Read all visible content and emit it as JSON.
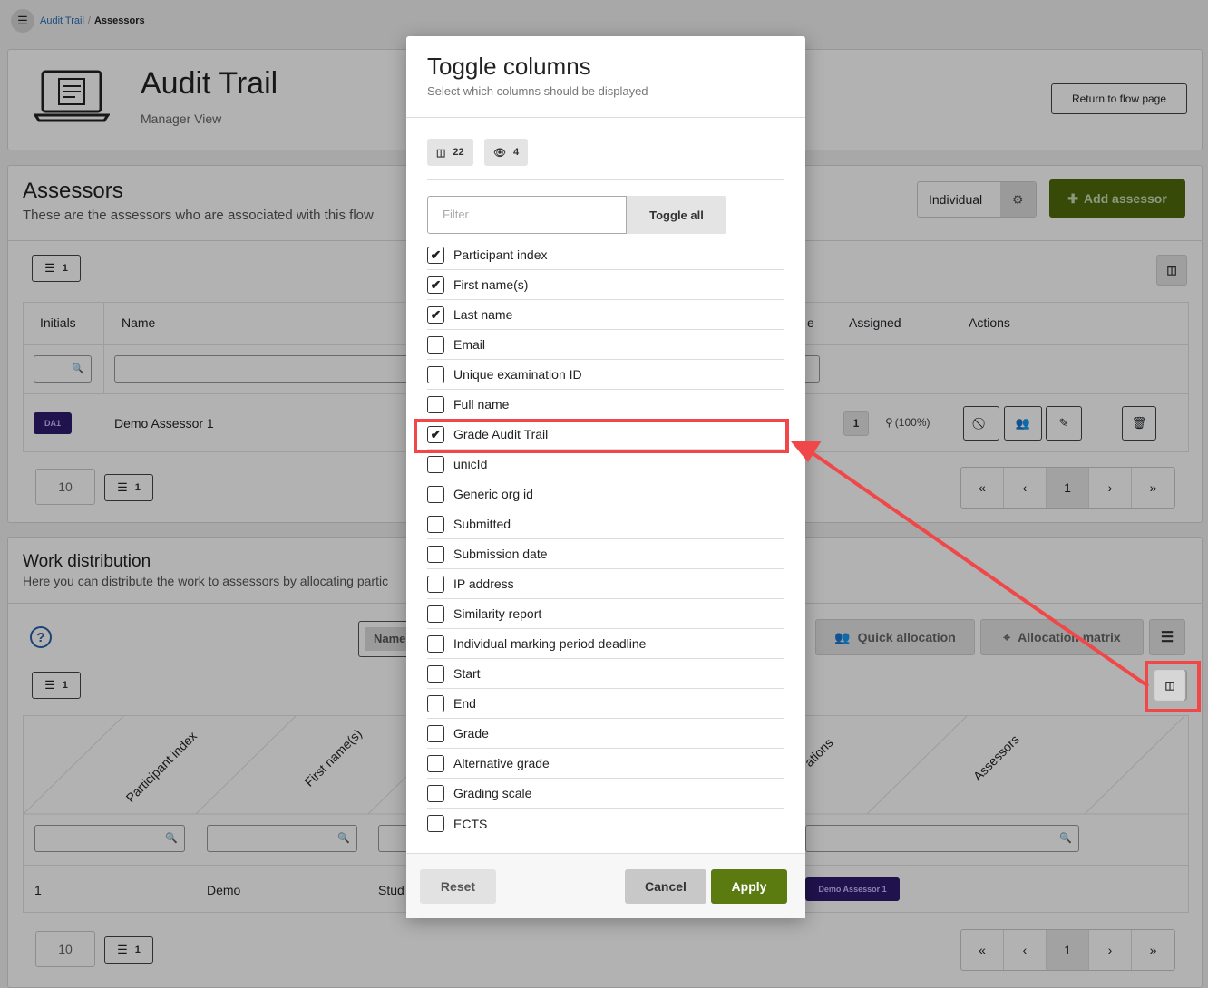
{
  "breadcrumb": {
    "root": "Audit Trail",
    "sep": "/",
    "current": "Assessors"
  },
  "header": {
    "title": "Audit Trail",
    "subtitle": "Manager View",
    "return_button": "Return to flow page"
  },
  "assessors": {
    "title": "Assessors",
    "description": "These are the assessors who are associated with this flow",
    "mode_label": "Individual",
    "add_button": "Add assessor",
    "list_count": "1",
    "columns": {
      "initials": "Initials",
      "name": "Name",
      "e": "e",
      "assigned": "Assigned",
      "actions": "Actions"
    },
    "row": {
      "initials": "DA1",
      "name": "Demo Assessor 1",
      "assigned": "1",
      "percent": "(100%)"
    },
    "page_size": "10",
    "page_count": "1",
    "pagination": {
      "first": "«",
      "prev": "‹",
      "current": "1",
      "next": "›",
      "last": "»"
    }
  },
  "work": {
    "title": "Work distribution",
    "description": "Here you can distribute the work to assessors by allocating partic",
    "select_label": "Name",
    "quick_allocation": "Quick allocation",
    "allocation_matrix": "Allocation matrix",
    "list_count": "1",
    "headers": [
      "Participant index",
      "First name(s)",
      "ations",
      "Assessors"
    ],
    "row": {
      "index": "1",
      "first": "Demo",
      "last": "Stud",
      "assessor": "Demo Assessor 1"
    },
    "page_size": "10",
    "page_count": "1",
    "pagination": {
      "first": "«",
      "prev": "‹",
      "current": "1",
      "next": "›",
      "last": "»"
    }
  },
  "modal": {
    "title": "Toggle columns",
    "subtitle": "Select which columns should be displayed",
    "total_columns": "22",
    "visible_columns": "4",
    "filter_placeholder": "Filter",
    "toggle_all": "Toggle all",
    "columns": [
      {
        "label": "Participant index",
        "checked": true
      },
      {
        "label": "First name(s)",
        "checked": true
      },
      {
        "label": "Last name",
        "checked": true
      },
      {
        "label": "Email",
        "checked": false
      },
      {
        "label": "Unique examination ID",
        "checked": false
      },
      {
        "label": "Full name",
        "checked": false
      },
      {
        "label": "Grade Audit Trail",
        "checked": true
      },
      {
        "label": "unicId",
        "checked": false
      },
      {
        "label": "Generic org id",
        "checked": false
      },
      {
        "label": "Submitted",
        "checked": false
      },
      {
        "label": "Submission date",
        "checked": false
      },
      {
        "label": "IP address",
        "checked": false
      },
      {
        "label": "Similarity report",
        "checked": false
      },
      {
        "label": "Individual marking period deadline",
        "checked": false
      },
      {
        "label": "Start",
        "checked": false
      },
      {
        "label": "End",
        "checked": false
      },
      {
        "label": "Grade",
        "checked": false
      },
      {
        "label": "Alternative grade",
        "checked": false
      },
      {
        "label": "Grading scale",
        "checked": false
      },
      {
        "label": "ECTS",
        "checked": false
      }
    ],
    "reset": "Reset",
    "cancel": "Cancel",
    "apply": "Apply"
  },
  "colors": {
    "accent_green": "#5b7a10",
    "highlight_red": "#f04848",
    "purple_badge": "#2e1a6e"
  }
}
